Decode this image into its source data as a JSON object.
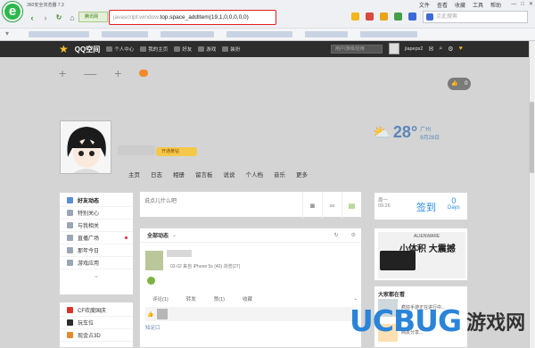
{
  "browser": {
    "title": "360安全浏览器 7.3",
    "menu": [
      "文件",
      "查看",
      "收藏",
      "工具",
      "帮助"
    ],
    "secure_label": "腾讯网",
    "address": {
      "scheme": "javascript:window.",
      "rest": "top.space_addItem(19,1,0,0,0,0,0)"
    },
    "search_placeholder": "点此搜索"
  },
  "qqbar": {
    "brand": "QQ空间",
    "items": [
      {
        "label": "个人中心",
        "icon": "home-icon"
      },
      {
        "label": "我的主页",
        "icon": "person-icon"
      },
      {
        "label": "好友",
        "icon": "friends-icon"
      },
      {
        "label": "游戏",
        "icon": "game-icon"
      },
      {
        "label": "装扮",
        "icon": "dress-icon"
      }
    ],
    "search_placeholder": "用户/游戏/应用",
    "user": "jiapeps2"
  },
  "toolbar_plus": [
    "+",
    "—",
    "+"
  ],
  "like_count": "0",
  "vip_label": "开通黄钻",
  "weather": {
    "temp": "28°",
    "city": "广州",
    "date": "9月28日"
  },
  "profile_nav": [
    "主页",
    "日志",
    "相册",
    "留言板",
    "说说",
    "个人档",
    "音乐",
    "更多"
  ],
  "left_nav": [
    {
      "label": "好友动态",
      "icon": "feed-icon",
      "active": true
    },
    {
      "label": "特别关心",
      "icon": "heart-icon"
    },
    {
      "label": "与我相关",
      "icon": "at-icon"
    },
    {
      "label": "直播广场",
      "icon": "live-icon",
      "dot": true
    },
    {
      "label": "那年今日",
      "icon": "calendar-icon"
    },
    {
      "label": "游戏应用",
      "icon": "apps-icon"
    }
  ],
  "left_apps": [
    {
      "label": "CF欢度国庆"
    },
    {
      "label": "玩车位"
    },
    {
      "label": "现金占3D"
    }
  ],
  "composer": {
    "placeholder": "说点儿什么吧"
  },
  "feed": {
    "filter": "全部动态",
    "post_meta": "02-02 来自 iPhone 5s (40)  浏览(27)",
    "actions": [
      "评论(1)",
      "转发",
      "赞(1)",
      "收藏"
    ],
    "comment": "知足口"
  },
  "checkin": {
    "weekday": "周一",
    "date": "09.26",
    "label": "签到",
    "days": "0",
    "days_unit": "Days"
  },
  "ad": {
    "title": "小体积 大震撼",
    "brand": "ALIENWARE"
  },
  "hot": {
    "title": "大家都在看",
    "lines": [
      "疯狂手游正在进行中...",
      "网友分享...",
      "..."
    ]
  },
  "watermark": {
    "latin": "UCBUG",
    "cn": "游戏网",
    "domain": ".com"
  }
}
